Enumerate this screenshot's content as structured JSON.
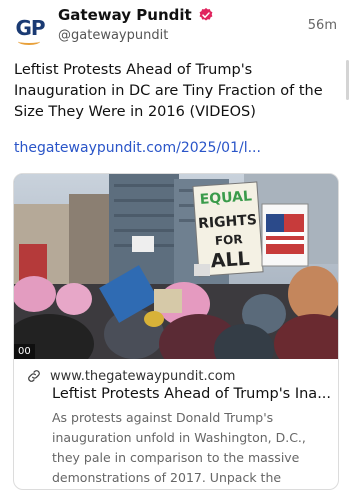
{
  "account": {
    "display_name": "Gateway Pundit",
    "handle": "@gatewaypundit",
    "avatar_text": "GP",
    "verified_icon": "verified-badge-icon",
    "brand_color": "#1a3a73",
    "accent_color": "#e8a03a"
  },
  "post": {
    "time": "56m",
    "text": "Leftist Protests Ahead of Trump's Inauguration in DC are Tiny Fraction of the Size They Were in 2016 (VIDEOS)",
    "link_text": "thegatewaypundit.com/2025/01/l..."
  },
  "card": {
    "media_duration": "00",
    "sign_text": "EQUAL RIGHTS FOR ALL",
    "domain": "www.thegatewaypundit.com",
    "title": "Leftist Protests Ahead of Trump's Ina...",
    "description": "As protests against Donald Trump's inauguration unfold in Washington, D.C., they pale in comparison to the massive demonstrations of 2017. Unpack the dynami...",
    "link_icon": "link-icon"
  },
  "colors": {
    "link": "#2a55c8",
    "verified": "#e0245e"
  }
}
